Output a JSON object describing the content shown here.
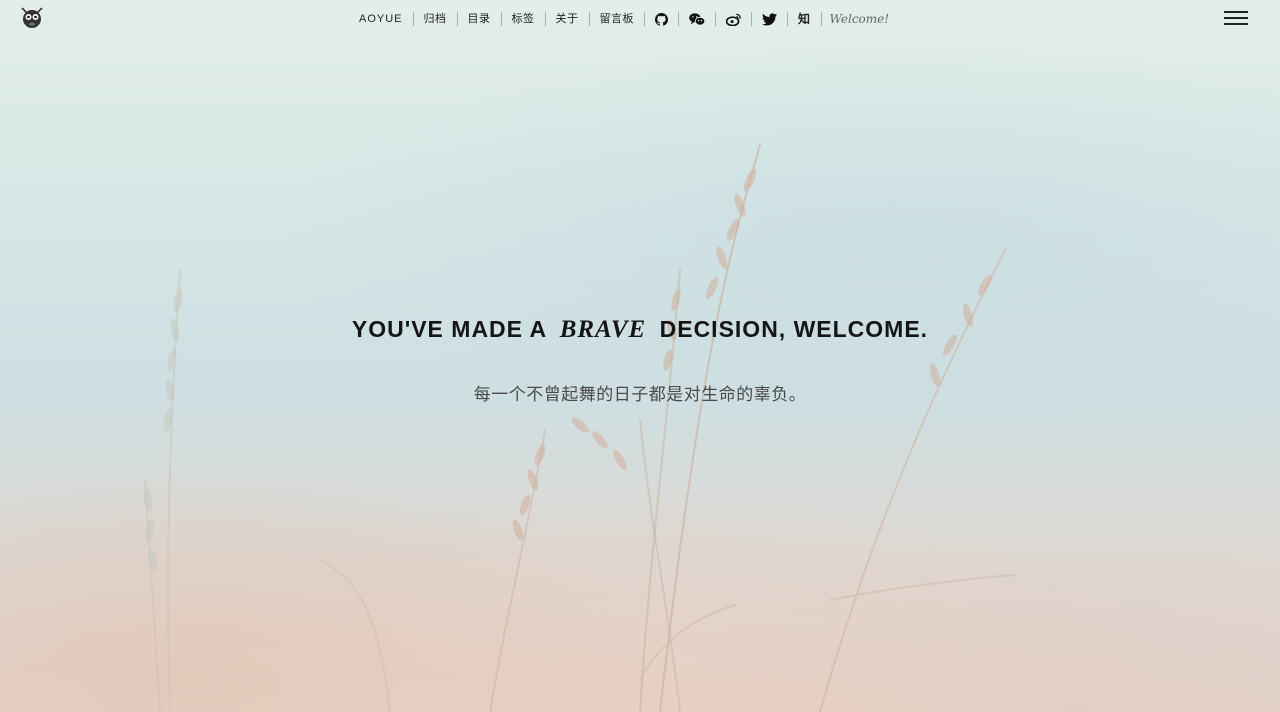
{
  "header": {
    "nav": [
      {
        "label": "AOYUE",
        "name": "nav-brand"
      },
      {
        "label": "归档",
        "name": "nav-archive"
      },
      {
        "label": "目录",
        "name": "nav-catalog"
      },
      {
        "label": "标签",
        "name": "nav-tags"
      },
      {
        "label": "关于",
        "name": "nav-about"
      },
      {
        "label": "留言板",
        "name": "nav-guestbook"
      }
    ],
    "social_icons": [
      "github-icon",
      "wechat-icon",
      "weibo-icon",
      "twitter-icon"
    ],
    "zhihu_label": "知",
    "welcome": "Welcome!"
  },
  "hero": {
    "headline_before": "YOU'VE MADE A",
    "headline_accent": "BRAVE",
    "headline_after": "DECISION, WELCOME.",
    "subtitle": "每一个不曾起舞的日子都是对生命的辜负。"
  }
}
